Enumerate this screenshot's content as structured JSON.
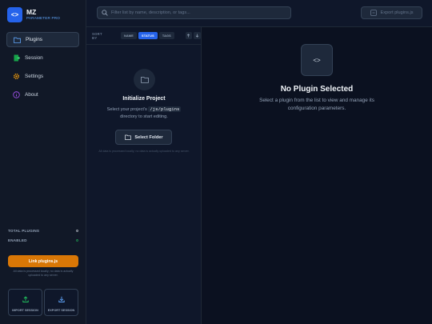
{
  "brand": {
    "title": "MZ",
    "subtitle": "PARAMETER PRO",
    "logo_icon": "code-icon"
  },
  "nav": [
    {
      "label": "Plugins",
      "icon": "folder-icon",
      "active": true
    },
    {
      "label": "Session",
      "icon": "session-file-icon"
    },
    {
      "label": "Settings",
      "icon": "gear-icon"
    },
    {
      "label": "About",
      "icon": "info-icon"
    }
  ],
  "stats": {
    "total_label": "TOTAL PLUGINS",
    "total_value": "0",
    "enabled_label": "ENABLED",
    "enabled_value": "0"
  },
  "sidebar_footer": {
    "link_label": "Link plugins.js",
    "link_note": "All data is processed locally; no data is actually uploaded to any server.",
    "import_label": "IMPORT SESSION",
    "export_label": "EXPORT SESSION"
  },
  "header": {
    "search_placeholder": "Filter list by name, description, or tags...",
    "export_label": "Export plugins.js"
  },
  "sortbar": {
    "label": "SORT BY",
    "options": [
      "NAME",
      "STATUS",
      "TAGS"
    ],
    "active": "STATUS"
  },
  "list_empty": {
    "title": "Initialize Project",
    "desc_before": "Select your project's",
    "desc_code": "/js/plugins",
    "desc_after": "directory to start editing.",
    "button_label": "Select Folder",
    "note": "All data is processed locally; no data is actually uploaded to any server."
  },
  "detail": {
    "title": "No Plugin Selected",
    "desc": "Select a plugin from the list to view and manage its configuration parameters."
  },
  "colors": {
    "accent": "#2563eb",
    "warning": "#d97706",
    "bg": "#0b1120",
    "panel": "#111827"
  }
}
